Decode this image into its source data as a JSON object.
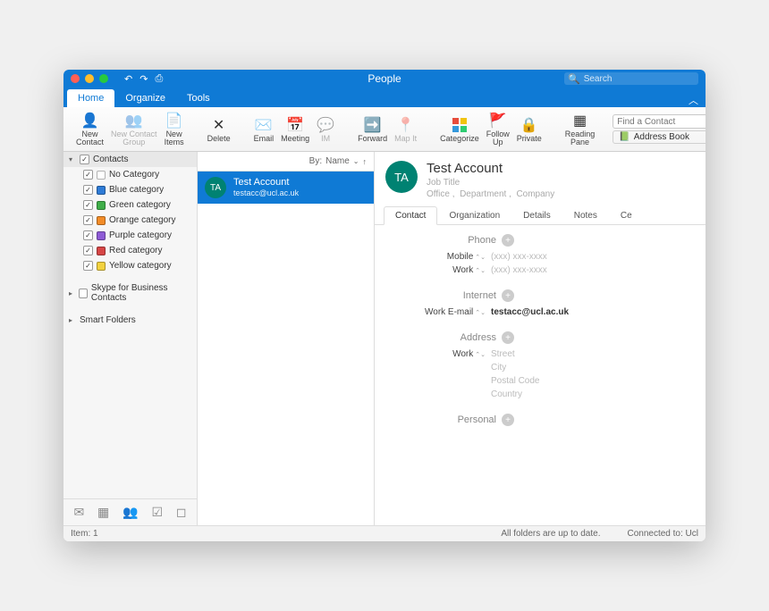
{
  "titlebar": {
    "title": "People",
    "search_placeholder": "Search"
  },
  "tabs": {
    "home": "Home",
    "organize": "Organize",
    "tools": "Tools"
  },
  "ribbon": {
    "new_contact": "New\nContact",
    "new_group": "New Contact\nGroup",
    "new_items": "New\nItems",
    "delete": "Delete",
    "email": "Email",
    "meeting": "Meeting",
    "im": "IM",
    "forward": "Forward",
    "map_it": "Map It",
    "categorize": "Categorize",
    "follow_up": "Follow\nUp",
    "private": "Private",
    "reading_pane": "Reading\nPane",
    "find_placeholder": "Find a Contact",
    "address_book": "Address Book"
  },
  "sidebar": {
    "contacts": "Contacts",
    "categories": [
      {
        "label": "No Category",
        "color": "#ffffff"
      },
      {
        "label": "Blue category",
        "color": "#2e7bd6"
      },
      {
        "label": "Green category",
        "color": "#3fae49"
      },
      {
        "label": "Orange category",
        "color": "#f28c28"
      },
      {
        "label": "Purple category",
        "color": "#8e5bd6"
      },
      {
        "label": "Red category",
        "color": "#d64545"
      },
      {
        "label": "Yellow category",
        "color": "#f2d23f"
      }
    ],
    "skype": "Skype for Business Contacts",
    "smart": "Smart Folders"
  },
  "list": {
    "by_label": "By:",
    "by_value": "Name",
    "items": [
      {
        "initials": "TA",
        "name": "Test Account",
        "email": "testacc@ucl.ac.uk",
        "avatar_color": "#008272"
      }
    ]
  },
  "detail": {
    "initials": "TA",
    "name": "Test  Account",
    "job_title": "Job Title",
    "loc_office": "Office",
    "loc_dept": "Department",
    "loc_company": "Company",
    "tabs": {
      "contact": "Contact",
      "organization": "Organization",
      "details": "Details",
      "notes": "Notes",
      "cert": "Ce"
    },
    "sections": {
      "phone": {
        "title": "Phone",
        "fields": [
          {
            "label": "Mobile",
            "value": "(xxx) xxx-xxxx",
            "placeholder": true
          },
          {
            "label": "Work",
            "value": "(xxx) xxx-xxxx",
            "placeholder": true
          }
        ]
      },
      "internet": {
        "title": "Internet",
        "fields": [
          {
            "label": "Work E-mail",
            "value": "testacc@ucl.ac.uk",
            "placeholder": false,
            "bold": true
          }
        ]
      },
      "address": {
        "title": "Address",
        "fields": [
          {
            "label": "Work",
            "value": "Street",
            "placeholder": true
          },
          {
            "label": "",
            "value": "City",
            "placeholder": true
          },
          {
            "label": "",
            "value": "Postal Code",
            "placeholder": true
          },
          {
            "label": "",
            "value": "Country",
            "placeholder": true
          }
        ]
      },
      "personal": {
        "title": "Personal"
      }
    }
  },
  "status": {
    "item_label": "Item:",
    "item_count": "1",
    "sync": "All folders are up to date.",
    "conn": "Connected to: Ucl"
  }
}
